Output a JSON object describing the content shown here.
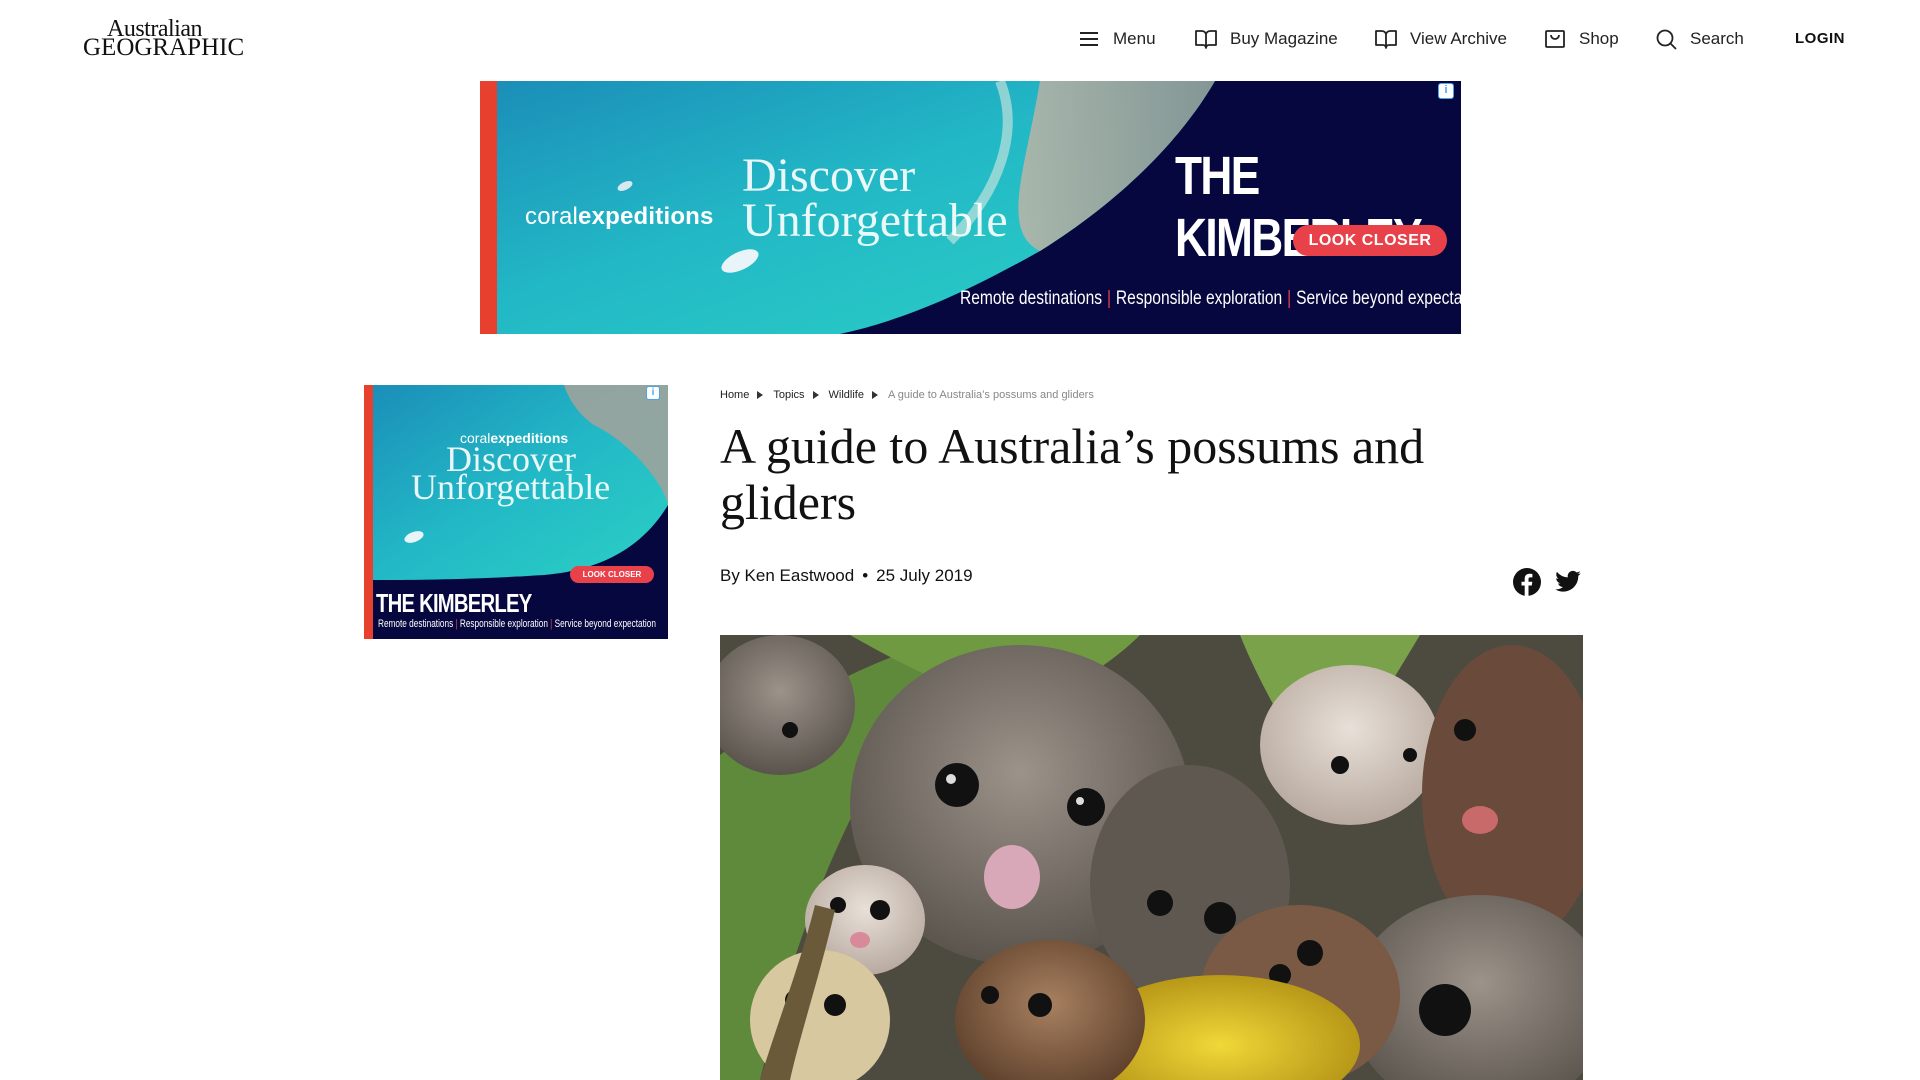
{
  "header": {
    "logo_line1": "Australian",
    "logo_line2": "GEOGRAPHIC",
    "nav": {
      "menu": "Menu",
      "buy_magazine": "Buy Magazine",
      "view_archive": "View Archive",
      "shop": "Shop",
      "search": "Search",
      "login": "LOGIN"
    },
    "icons": [
      "menu-icon",
      "book-icon",
      "book-icon",
      "shop-icon",
      "search-icon"
    ]
  },
  "banner_ad": {
    "brand_light": "coral",
    "brand_bold": "expeditions",
    "slogan_line1": "Discover",
    "slogan_line2": "Unforgettable",
    "headline": "THE KIMBERLEY",
    "cta": "LOOK CLOSER",
    "tagline": [
      "Remote destinations",
      "Responsible exploration",
      "Service beyond expectation"
    ]
  },
  "side_ad": {
    "brand_light": "coral",
    "brand_bold": "expeditions",
    "slogan_line1": "Discover",
    "slogan_line2": "Unforgettable",
    "headline": "THE KIMBERLEY",
    "cta": "LOOK CLOSER",
    "tagline": [
      "Remote destinations",
      "Responsible exploration",
      "Service beyond expectation"
    ]
  },
  "article": {
    "breadcrumb": [
      "Home",
      "Topics",
      "Wildlife",
      "A guide to Australia’s possums and gliders"
    ],
    "title": "A guide to Australia’s possums and gliders",
    "byline": "By Ken Eastwood",
    "date": "25 July 2019",
    "share": [
      "facebook-icon",
      "twitter-icon"
    ]
  },
  "colors": {
    "ad_navy": "#06073f",
    "ad_red": "#e8414a",
    "ad_teal": "#1fb8c8"
  }
}
